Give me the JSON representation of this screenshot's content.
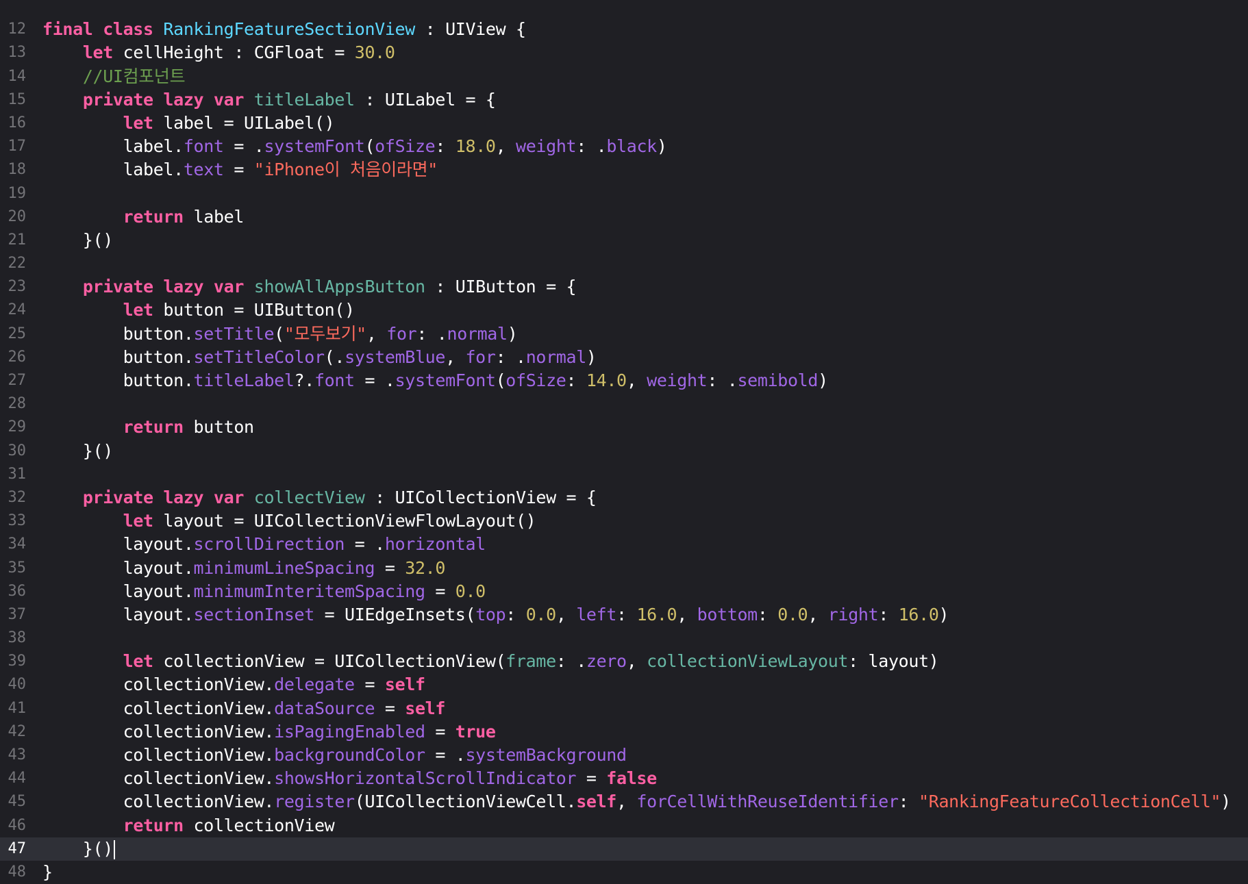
{
  "editor": {
    "current_line": 47,
    "lines": [
      {
        "num": "",
        "tokens": []
      },
      {
        "num": "12",
        "tokens": [
          {
            "t": "final class ",
            "c": "kw"
          },
          {
            "t": "RankingFeatureSectionView",
            "c": "decl"
          },
          {
            "t": " : UIView {",
            "c": "pl"
          }
        ]
      },
      {
        "num": "13",
        "tokens": [
          {
            "t": "    ",
            "c": "pl"
          },
          {
            "t": "let",
            "c": "kw"
          },
          {
            "t": " cellHeight : CGFloat = ",
            "c": "pl"
          },
          {
            "t": "30.0",
            "c": "num"
          }
        ]
      },
      {
        "num": "14",
        "tokens": [
          {
            "t": "    ",
            "c": "pl"
          },
          {
            "t": "//UI컴포넌트",
            "c": "cmt"
          }
        ]
      },
      {
        "num": "15",
        "tokens": [
          {
            "t": "    ",
            "c": "pl"
          },
          {
            "t": "private lazy var",
            "c": "kw"
          },
          {
            "t": " ",
            "c": "pl"
          },
          {
            "t": "titleLabel",
            "c": "prop"
          },
          {
            "t": " : UILabel = {",
            "c": "pl"
          }
        ]
      },
      {
        "num": "16",
        "tokens": [
          {
            "t": "        ",
            "c": "pl"
          },
          {
            "t": "let",
            "c": "kw"
          },
          {
            "t": " label = UILabel()",
            "c": "pl"
          }
        ]
      },
      {
        "num": "17",
        "tokens": [
          {
            "t": "        label.",
            "c": "pl"
          },
          {
            "t": "font",
            "c": "mem"
          },
          {
            "t": " = .",
            "c": "pl"
          },
          {
            "t": "systemFont",
            "c": "mem"
          },
          {
            "t": "(",
            "c": "pl"
          },
          {
            "t": "ofSize",
            "c": "mem"
          },
          {
            "t": ": ",
            "c": "pl"
          },
          {
            "t": "18.0",
            "c": "num"
          },
          {
            "t": ", ",
            "c": "pl"
          },
          {
            "t": "weight",
            "c": "mem"
          },
          {
            "t": ": .",
            "c": "pl"
          },
          {
            "t": "black",
            "c": "mem"
          },
          {
            "t": ")",
            "c": "pl"
          }
        ]
      },
      {
        "num": "18",
        "tokens": [
          {
            "t": "        label.",
            "c": "pl"
          },
          {
            "t": "text",
            "c": "mem"
          },
          {
            "t": " = ",
            "c": "pl"
          },
          {
            "t": "\"iPhone이 처음이라면\"",
            "c": "str"
          }
        ]
      },
      {
        "num": "19",
        "tokens": []
      },
      {
        "num": "20",
        "tokens": [
          {
            "t": "        ",
            "c": "pl"
          },
          {
            "t": "return",
            "c": "kw"
          },
          {
            "t": " label",
            "c": "pl"
          }
        ]
      },
      {
        "num": "21",
        "tokens": [
          {
            "t": "    }()",
            "c": "pl"
          }
        ]
      },
      {
        "num": "22",
        "tokens": []
      },
      {
        "num": "23",
        "tokens": [
          {
            "t": "    ",
            "c": "pl"
          },
          {
            "t": "private lazy var",
            "c": "kw"
          },
          {
            "t": " ",
            "c": "pl"
          },
          {
            "t": "showAllAppsButton",
            "c": "prop"
          },
          {
            "t": " : UIButton = {",
            "c": "pl"
          }
        ]
      },
      {
        "num": "24",
        "tokens": [
          {
            "t": "        ",
            "c": "pl"
          },
          {
            "t": "let",
            "c": "kw"
          },
          {
            "t": " button = UIButton()",
            "c": "pl"
          }
        ]
      },
      {
        "num": "25",
        "tokens": [
          {
            "t": "        button.",
            "c": "pl"
          },
          {
            "t": "setTitle",
            "c": "mem"
          },
          {
            "t": "(",
            "c": "pl"
          },
          {
            "t": "\"모두보기\"",
            "c": "str"
          },
          {
            "t": ", ",
            "c": "pl"
          },
          {
            "t": "for",
            "c": "mem"
          },
          {
            "t": ": .",
            "c": "pl"
          },
          {
            "t": "normal",
            "c": "mem"
          },
          {
            "t": ")",
            "c": "pl"
          }
        ]
      },
      {
        "num": "26",
        "tokens": [
          {
            "t": "        button.",
            "c": "pl"
          },
          {
            "t": "setTitleColor",
            "c": "mem"
          },
          {
            "t": "(.",
            "c": "pl"
          },
          {
            "t": "systemBlue",
            "c": "mem"
          },
          {
            "t": ", ",
            "c": "pl"
          },
          {
            "t": "for",
            "c": "mem"
          },
          {
            "t": ": .",
            "c": "pl"
          },
          {
            "t": "normal",
            "c": "mem"
          },
          {
            "t": ")",
            "c": "pl"
          }
        ]
      },
      {
        "num": "27",
        "tokens": [
          {
            "t": "        button.",
            "c": "pl"
          },
          {
            "t": "titleLabel",
            "c": "mem"
          },
          {
            "t": "?.",
            "c": "pl"
          },
          {
            "t": "font",
            "c": "mem"
          },
          {
            "t": " = .",
            "c": "pl"
          },
          {
            "t": "systemFont",
            "c": "mem"
          },
          {
            "t": "(",
            "c": "pl"
          },
          {
            "t": "ofSize",
            "c": "mem"
          },
          {
            "t": ": ",
            "c": "pl"
          },
          {
            "t": "14.0",
            "c": "num"
          },
          {
            "t": ", ",
            "c": "pl"
          },
          {
            "t": "weight",
            "c": "mem"
          },
          {
            "t": ": .",
            "c": "pl"
          },
          {
            "t": "semibold",
            "c": "mem"
          },
          {
            "t": ")",
            "c": "pl"
          }
        ]
      },
      {
        "num": "28",
        "tokens": []
      },
      {
        "num": "29",
        "tokens": [
          {
            "t": "        ",
            "c": "pl"
          },
          {
            "t": "return",
            "c": "kw"
          },
          {
            "t": " button",
            "c": "pl"
          }
        ]
      },
      {
        "num": "30",
        "tokens": [
          {
            "t": "    }()",
            "c": "pl"
          }
        ]
      },
      {
        "num": "31",
        "tokens": []
      },
      {
        "num": "32",
        "tokens": [
          {
            "t": "    ",
            "c": "pl"
          },
          {
            "t": "private lazy var",
            "c": "kw"
          },
          {
            "t": " ",
            "c": "pl"
          },
          {
            "t": "collectView",
            "c": "prop"
          },
          {
            "t": " : UICollectionView = {",
            "c": "pl"
          }
        ]
      },
      {
        "num": "33",
        "tokens": [
          {
            "t": "        ",
            "c": "pl"
          },
          {
            "t": "let",
            "c": "kw"
          },
          {
            "t": " layout = UICollectionViewFlowLayout()",
            "c": "pl"
          }
        ]
      },
      {
        "num": "34",
        "tokens": [
          {
            "t": "        layout.",
            "c": "pl"
          },
          {
            "t": "scrollDirection",
            "c": "mem"
          },
          {
            "t": " = .",
            "c": "pl"
          },
          {
            "t": "horizontal",
            "c": "mem"
          }
        ]
      },
      {
        "num": "35",
        "tokens": [
          {
            "t": "        layout.",
            "c": "pl"
          },
          {
            "t": "minimumLineSpacing",
            "c": "mem"
          },
          {
            "t": " = ",
            "c": "pl"
          },
          {
            "t": "32.0",
            "c": "num"
          }
        ]
      },
      {
        "num": "36",
        "tokens": [
          {
            "t": "        layout.",
            "c": "pl"
          },
          {
            "t": "minimumInteritemSpacing",
            "c": "mem"
          },
          {
            "t": " = ",
            "c": "pl"
          },
          {
            "t": "0.0",
            "c": "num"
          }
        ]
      },
      {
        "num": "37",
        "tokens": [
          {
            "t": "        layout.",
            "c": "pl"
          },
          {
            "t": "sectionInset",
            "c": "mem"
          },
          {
            "t": " = UIEdgeInsets(",
            "c": "pl"
          },
          {
            "t": "top",
            "c": "mem"
          },
          {
            "t": ": ",
            "c": "pl"
          },
          {
            "t": "0.0",
            "c": "num"
          },
          {
            "t": ", ",
            "c": "pl"
          },
          {
            "t": "left",
            "c": "mem"
          },
          {
            "t": ": ",
            "c": "pl"
          },
          {
            "t": "16.0",
            "c": "num"
          },
          {
            "t": ", ",
            "c": "pl"
          },
          {
            "t": "bottom",
            "c": "mem"
          },
          {
            "t": ": ",
            "c": "pl"
          },
          {
            "t": "0.0",
            "c": "num"
          },
          {
            "t": ", ",
            "c": "pl"
          },
          {
            "t": "right",
            "c": "mem"
          },
          {
            "t": ": ",
            "c": "pl"
          },
          {
            "t": "16.0",
            "c": "num"
          },
          {
            "t": ")",
            "c": "pl"
          }
        ]
      },
      {
        "num": "38",
        "tokens": []
      },
      {
        "num": "39",
        "tokens": [
          {
            "t": "        ",
            "c": "pl"
          },
          {
            "t": "let",
            "c": "kw"
          },
          {
            "t": " collectionView = UICollectionView(",
            "c": "pl"
          },
          {
            "t": "frame",
            "c": "prop"
          },
          {
            "t": ": .",
            "c": "pl"
          },
          {
            "t": "zero",
            "c": "mem"
          },
          {
            "t": ", ",
            "c": "pl"
          },
          {
            "t": "collectionViewLayout",
            "c": "prop"
          },
          {
            "t": ": layout)",
            "c": "pl"
          }
        ]
      },
      {
        "num": "40",
        "tokens": [
          {
            "t": "        collectionView.",
            "c": "pl"
          },
          {
            "t": "delegate",
            "c": "mem"
          },
          {
            "t": " = ",
            "c": "pl"
          },
          {
            "t": "self",
            "c": "kw"
          }
        ]
      },
      {
        "num": "41",
        "tokens": [
          {
            "t": "        collectionView.",
            "c": "pl"
          },
          {
            "t": "dataSource",
            "c": "mem"
          },
          {
            "t": " = ",
            "c": "pl"
          },
          {
            "t": "self",
            "c": "kw"
          }
        ]
      },
      {
        "num": "42",
        "tokens": [
          {
            "t": "        collectionView.",
            "c": "pl"
          },
          {
            "t": "isPagingEnabled",
            "c": "mem"
          },
          {
            "t": " = ",
            "c": "pl"
          },
          {
            "t": "true",
            "c": "kw"
          }
        ]
      },
      {
        "num": "43",
        "tokens": [
          {
            "t": "        collectionView.",
            "c": "pl"
          },
          {
            "t": "backgroundColor",
            "c": "mem"
          },
          {
            "t": " = .",
            "c": "pl"
          },
          {
            "t": "systemBackground",
            "c": "mem"
          }
        ]
      },
      {
        "num": "44",
        "tokens": [
          {
            "t": "        collectionView.",
            "c": "pl"
          },
          {
            "t": "showsHorizontalScrollIndicator",
            "c": "mem"
          },
          {
            "t": " = ",
            "c": "pl"
          },
          {
            "t": "false",
            "c": "kw"
          }
        ]
      },
      {
        "num": "45",
        "tokens": [
          {
            "t": "        collectionView.",
            "c": "pl"
          },
          {
            "t": "register",
            "c": "mem"
          },
          {
            "t": "(UICollectionViewCell.",
            "c": "pl"
          },
          {
            "t": "self",
            "c": "kw"
          },
          {
            "t": ", ",
            "c": "pl"
          },
          {
            "t": "forCellWithReuseIdentifier",
            "c": "mem"
          },
          {
            "t": ": ",
            "c": "pl"
          },
          {
            "t": "\"RankingFeatureCollectionCell\"",
            "c": "str"
          },
          {
            "t": ")",
            "c": "pl"
          }
        ]
      },
      {
        "num": "46",
        "tokens": [
          {
            "t": "        ",
            "c": "pl"
          },
          {
            "t": "return",
            "c": "kw"
          },
          {
            "t": " collectionView",
            "c": "pl"
          }
        ]
      },
      {
        "num": "47",
        "tokens": [
          {
            "t": "    }()",
            "c": "pl"
          }
        ]
      },
      {
        "num": "48",
        "tokens": [
          {
            "t": "}",
            "c": "pl"
          }
        ]
      }
    ]
  },
  "colors": {
    "background": "#1f1f24",
    "current_line_bg": "#2f3037",
    "keyword": "#fc5fa3",
    "declaration": "#5dd8ff",
    "property_decl": "#67b7a4",
    "member": "#a167e6",
    "number": "#d0bf69",
    "string": "#fc6a5d",
    "comment": "#6c9f4f",
    "line_number": "#747478"
  }
}
